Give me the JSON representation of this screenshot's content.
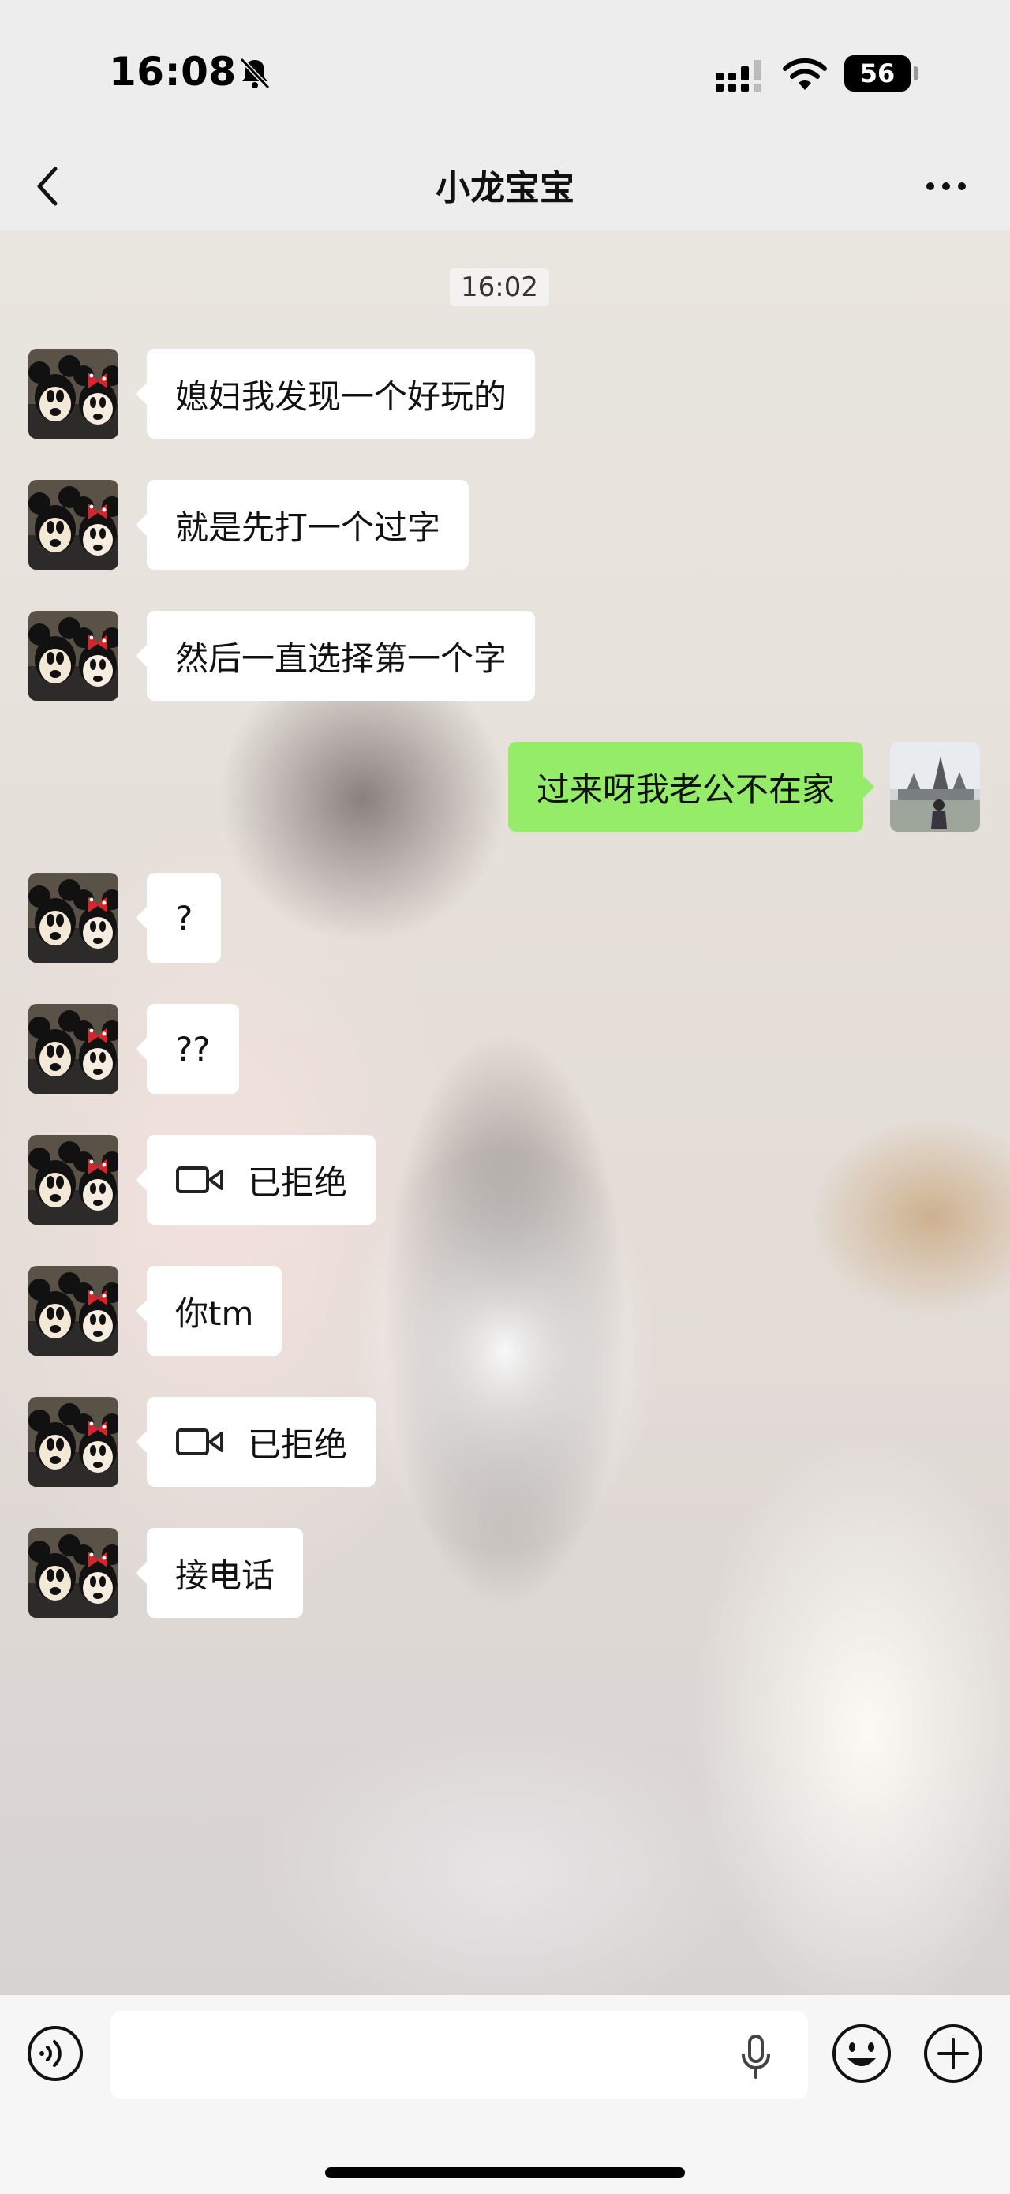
{
  "status_bar": {
    "time": "16:08",
    "battery": "56"
  },
  "nav": {
    "title": "小龙宝宝"
  },
  "chat": {
    "time_stamp": "16:02",
    "messages": [
      {
        "side": "received",
        "text": "媳妇我发现一个好玩的"
      },
      {
        "side": "received",
        "text": "就是先打一个过字"
      },
      {
        "side": "received",
        "text": "然后一直选择第一个字"
      },
      {
        "side": "sent",
        "text": "过来呀我老公不在家"
      },
      {
        "side": "received",
        "text": "?"
      },
      {
        "side": "received",
        "text": "??"
      },
      {
        "side": "received",
        "text": "已拒绝",
        "icon": "video-call-icon"
      },
      {
        "side": "received",
        "text": "你tm"
      },
      {
        "side": "received",
        "text": "已拒绝",
        "icon": "video-call-icon"
      },
      {
        "side": "received",
        "text": "接电话"
      }
    ]
  },
  "input_bar": {
    "placeholder": ""
  },
  "colors": {
    "sent_bubble": "#95ec69",
    "received_bubble": "#ffffff",
    "bar_background": "#ededed"
  }
}
